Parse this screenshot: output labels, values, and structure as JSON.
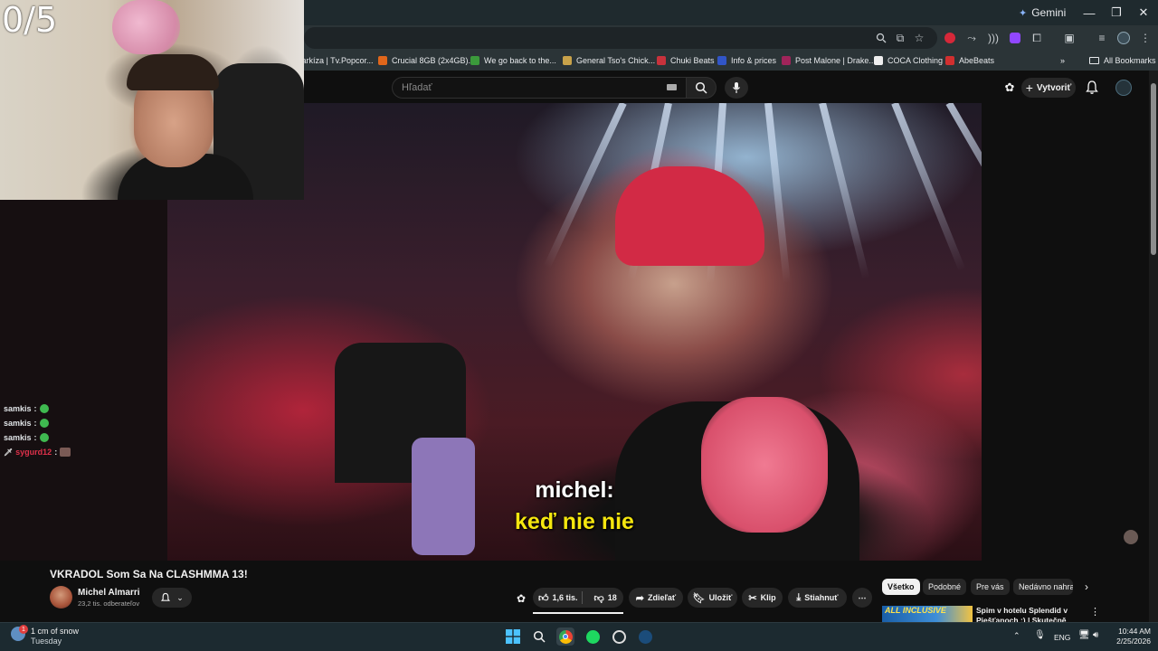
{
  "browser": {
    "gemini_label": "Gemini",
    "bookmarks": [
      {
        "label": "Markíza | Tv.Popcor...",
        "color": "#6a1f8a"
      },
      {
        "label": "Crucial 8GB (2x4GB)...",
        "color": "#e0661b"
      },
      {
        "label": "We go back to the...",
        "color": "#3b9a3b"
      },
      {
        "label": "General Tso's Chick...",
        "color": "#c8a24a"
      },
      {
        "label": "Chuki Beats",
        "color": "#c8323c"
      },
      {
        "label": "Info & prices",
        "color": "#3155c7"
      },
      {
        "label": "Post Malone | Drake...",
        "color": "#a0245a"
      },
      {
        "label": "COCA Clothing",
        "color": "#222222"
      },
      {
        "label": "AbeBeats",
        "color": "#d12f2f"
      }
    ],
    "all_bookmarks": "All Bookmarks"
  },
  "youtube": {
    "search_placeholder": "Hľadať",
    "create_label": "Vytvoriť"
  },
  "overlay": {
    "counter": "0/5",
    "chat": [
      {
        "name": "samkis",
        "sep": ":",
        "color": "#dfe3e6"
      },
      {
        "name": "samkis",
        "sep": ":",
        "color": "#dfe3e6"
      },
      {
        "name": "samkis",
        "sep": ":",
        "color": "#dfe3e6"
      },
      {
        "name": "sygurd12",
        "sep": ":",
        "color": "#e0314b"
      }
    ]
  },
  "video": {
    "subtitle_line1": "michel:",
    "subtitle_line2": "keď nie nie"
  },
  "below": {
    "title": "VKRADOL Som Sa Na CLASHMMA 13!",
    "channel_name": "Michel Almarri",
    "channel_subs": "23,2 tis. odberateľov",
    "like_count": "1,6 tis.",
    "dislike_count": "18",
    "share_label": "Zdieľať",
    "save_label": "Uložiť",
    "clip_label": "Klip",
    "download_label": "Stiahnuť",
    "chips": [
      "Všetko",
      "Podobné",
      "Pre vás",
      "Nedávno nahra"
    ],
    "rec_title": "Spim v hotelu Splendid v Piešťanoch :) | Skutečně All",
    "rec_thumb_text": "ALL INCLUSIVE"
  },
  "taskbar": {
    "weather_temp": "1 cm of snow",
    "weather_day": "Tuesday",
    "weather_badge": "1",
    "lang": "ENG",
    "time": "10:44 AM",
    "date": "2/25/2026"
  }
}
